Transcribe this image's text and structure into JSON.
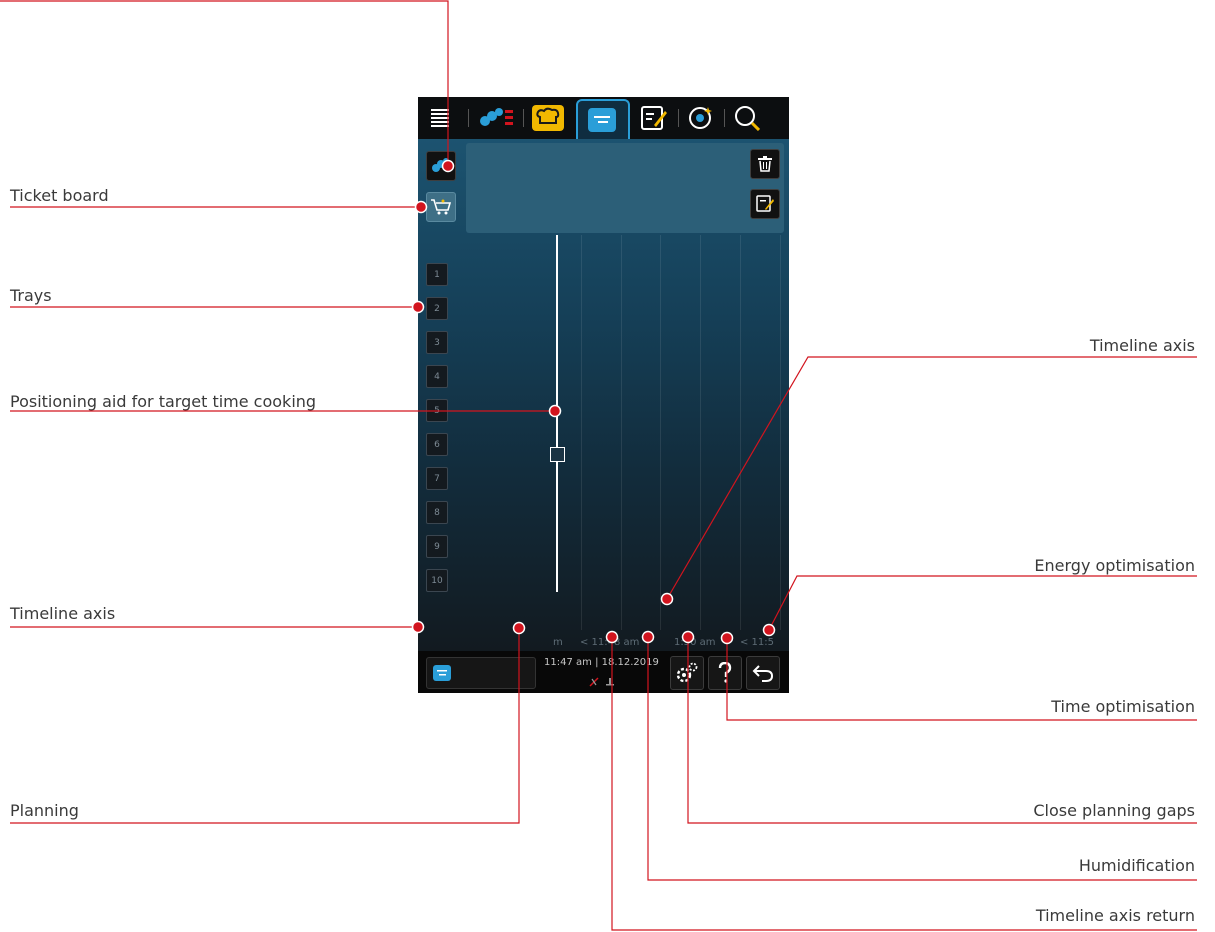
{
  "annotations": {
    "ticket_board": "Ticket board",
    "trays": "Trays",
    "positioning_aid": "Positioning aid for target time cooking",
    "timeline_axis_left": "Timeline axis",
    "planning": "Planning",
    "timeline_axis_right": "Timeline axis",
    "energy_optimisation": "Energy optimisation",
    "time_optimisation": "Time optimisation",
    "close_planning_gaps": "Close planning gaps",
    "humidification": "Humidification",
    "timeline_axis_return": "Timeline axis return"
  },
  "colors": {
    "annotation_line": "#d2141e",
    "annotation_dot": "#d2141e",
    "accent": "#2a9ed8",
    "panel": "#2c5f78"
  },
  "topbar": {
    "tabs": [
      "menu-icon",
      "cooking-paths-icon",
      "chef-hat-icon",
      "planning-icon",
      "recipe-edit-icon",
      "explore-icon",
      "search-icon"
    ],
    "active_tab": "planning-icon"
  },
  "trays": [
    "1",
    "2",
    "3",
    "4",
    "5",
    "6",
    "7",
    "8",
    "9",
    "10"
  ],
  "timeline": {
    "labels": [
      "m",
      "< 11:48 am",
      "1:50 am",
      "< 11:5"
    ]
  },
  "footer": {
    "time": "11:47 am",
    "separator": "|",
    "date": "18.12.2019"
  }
}
